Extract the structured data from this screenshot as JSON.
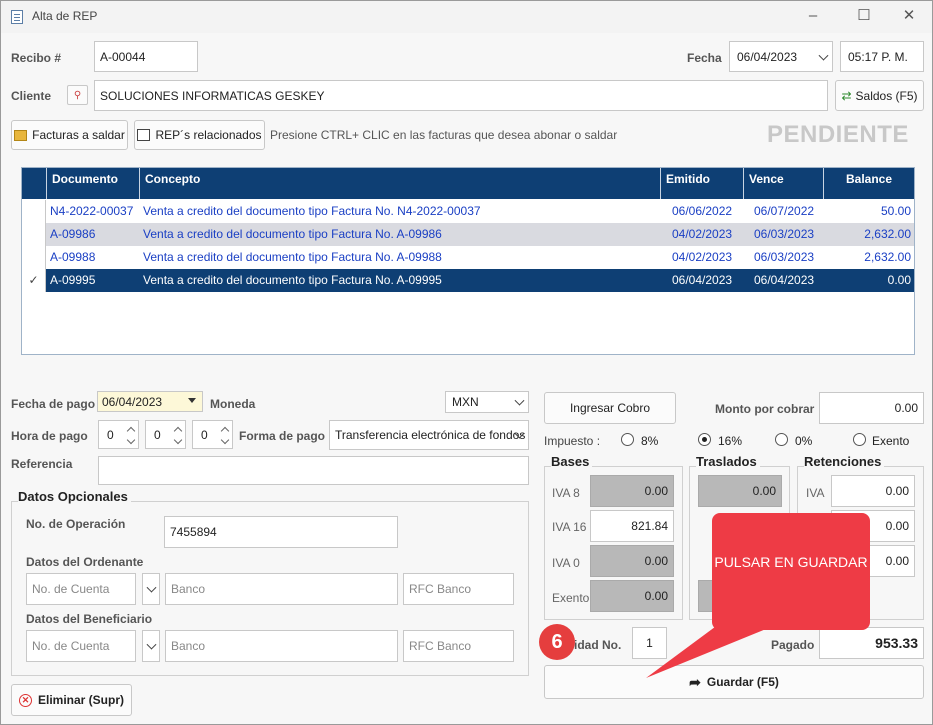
{
  "window": {
    "title": "Alta de REP"
  },
  "header": {
    "recibo_label": "Recibo #",
    "recibo_value": "A-00044",
    "fecha_label": "Fecha",
    "fecha_value": "06/04/2023",
    "hora_value": "05:17 P. M.",
    "cliente_label": "Cliente",
    "cliente_value": "SOLUCIONES INFORMATICAS GESKEY",
    "saldos_label": "Saldos (F5)"
  },
  "toolbar": {
    "facturas_label": "Facturas a saldar",
    "rep_label": "REP´s relacionados",
    "hint": "Presione CTRL+ CLIC en las facturas que desea abonar o saldar",
    "status": "PENDIENTE"
  },
  "table": {
    "columns": [
      "Documento",
      "Concepto",
      "Emitido",
      "Vence",
      "Balance"
    ],
    "rows": [
      {
        "documento": "N4-2022-00037",
        "concepto": "Venta a credito del documento tipo Factura No. N4-2022-00037",
        "emitido": "06/06/2022",
        "vence": "06/07/2022",
        "balance": "50.00"
      },
      {
        "documento": "A-09986",
        "concepto": "Venta a credito del documento tipo Factura No. A-09986",
        "emitido": "04/02/2023",
        "vence": "06/03/2023",
        "balance": "2,632.00"
      },
      {
        "documento": "A-09988",
        "concepto": "Venta a credito del documento tipo Factura No. A-09988",
        "emitido": "04/02/2023",
        "vence": "06/03/2023",
        "balance": "2,632.00"
      },
      {
        "documento": "A-09995",
        "concepto": "Venta a credito del documento tipo Factura No. A-09995",
        "emitido": "06/04/2023",
        "vence": "06/04/2023",
        "balance": "0.00"
      }
    ]
  },
  "payment": {
    "fecha_pago_label": "Fecha de pago",
    "fecha_pago_value": "06/04/2023",
    "moneda_label": "Moneda",
    "moneda_value": "MXN",
    "hora_pago_label": "Hora de pago",
    "hora_h": "0",
    "hora_m": "0",
    "hora_s": "0",
    "forma_pago_label": "Forma de pago",
    "forma_pago_value": "Transferencia electrónica de fondos",
    "referencia_label": "Referencia"
  },
  "opcionales": {
    "title": "Datos Opcionales",
    "operacion_label": "No. de Operación",
    "operacion_value": "7455894",
    "ordenante_label": "Datos del Ordenante",
    "beneficiario_label": "Datos del Beneficiario",
    "cuenta_ph": "No. de Cuenta",
    "banco_ph": "Banco",
    "rfc_ph": "RFC Banco"
  },
  "right": {
    "ingresar_label": "Ingresar Cobro",
    "monto_label": "Monto por cobrar",
    "monto_value": "0.00",
    "impuesto_label": "Impuesto :",
    "radios": [
      "8%",
      "16%",
      "0%",
      "Exento"
    ],
    "bases_title": "Bases",
    "traslados_title": "Traslados",
    "retenciones_title": "Retenciones",
    "iva8_label": "IVA 8",
    "iva16_label": "IVA 16",
    "iva0_label": "IVA 0",
    "exento_label": "Exento",
    "iva_label": "IVA",
    "bases_iva8": "0.00",
    "bases_iva16": "821.84",
    "bases_iva0": "0.00",
    "bases_exento": "0.00",
    "traslados_iva8": "0.00",
    "ret_1": "0.00",
    "ret_2": "0.00",
    "ret_3": "0.00",
    "parcialidad_label": "alidad No.",
    "parcialidad_value": "1",
    "pagado_label": "Pagado",
    "pagado_value": "953.33",
    "guardar_label": "Guardar (F5)"
  },
  "footer": {
    "eliminar_label": "Eliminar (Supr)"
  },
  "annotation": {
    "callout_text": "PULSAR EN GUARDAR",
    "step": "6",
    "color": "#ee3b45"
  }
}
